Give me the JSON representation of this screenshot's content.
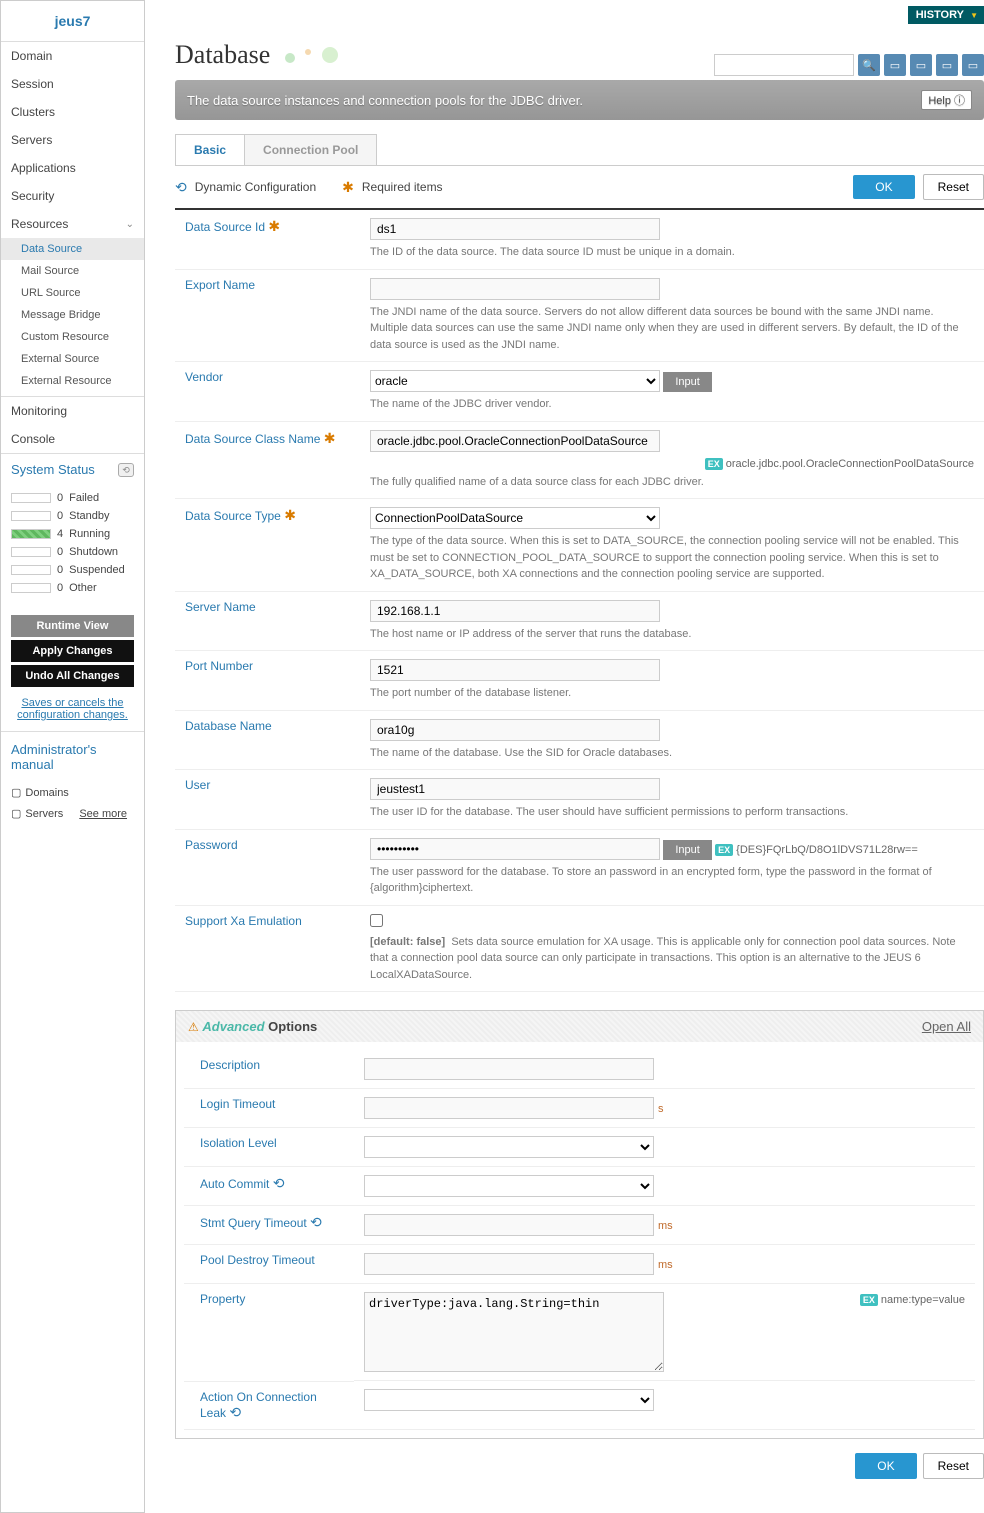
{
  "logo": "jeus7",
  "sidebar": {
    "main": [
      "Domain",
      "Session",
      "Clusters",
      "Servers",
      "Applications",
      "Security",
      "Resources"
    ],
    "resources_sub": [
      "Data Source",
      "Mail Source",
      "URL Source",
      "Message Bridge",
      "Custom Resource",
      "External Source",
      "External Resource"
    ],
    "monitoring": "Monitoring",
    "console": "Console",
    "system_status": "System Status",
    "status": [
      {
        "count": "0",
        "label": "Failed",
        "green": false
      },
      {
        "count": "0",
        "label": "Standby",
        "green": false
      },
      {
        "count": "4",
        "label": "Running",
        "green": true
      },
      {
        "count": "0",
        "label": "Shutdown",
        "green": false
      },
      {
        "count": "0",
        "label": "Suspended",
        "green": false
      },
      {
        "count": "0",
        "label": "Other",
        "green": false
      }
    ],
    "runtime_btn": "Runtime View",
    "apply_btn": "Apply Changes",
    "undo_btn": "Undo All Changes",
    "save_link": "Saves or cancels the configuration changes.",
    "admin_title": "Administrator's manual",
    "admin_items": [
      "Domains",
      "Servers"
    ],
    "see_more": "See more"
  },
  "history": "HISTORY",
  "page_title": "Database",
  "subtitle": "The data source instances and connection pools for the JDBC driver.",
  "help": "Help ⓘ",
  "tabs": [
    "Basic",
    "Connection Pool"
  ],
  "legend": {
    "dynamic": "Dynamic Configuration",
    "required": "Required items"
  },
  "ok": "OK",
  "reset": "Reset",
  "fields": {
    "datasource_id": {
      "label": "Data Source Id",
      "value": "ds1",
      "desc": "The ID of the data source. The data source ID must be unique in a domain.",
      "required": true
    },
    "export_name": {
      "label": "Export Name",
      "value": "",
      "desc": "The JNDI name of the data source. Servers do not allow different data sources be bound with the same JNDI name. Multiple data sources can use the same JNDI name only when they are used in different servers. By default, the ID of the data source is used as the JNDI name."
    },
    "vendor": {
      "label": "Vendor",
      "value": "oracle",
      "desc": "The name of the JDBC driver vendor.",
      "input_btn": "Input"
    },
    "ds_class": {
      "label": "Data Source Class Name",
      "value": "oracle.jdbc.pool.OracleConnectionPoolDataSource",
      "ex": "oracle.jdbc.pool.OracleConnectionPoolDataSource",
      "desc": "The fully qualified name of a data source class for each JDBC driver.",
      "required": true
    },
    "ds_type": {
      "label": "Data Source Type",
      "value": "ConnectionPoolDataSource",
      "desc": "The type of the data source. When this is set to DATA_SOURCE, the connection pooling service will not be enabled. This must be set to CONNECTION_POOL_DATA_SOURCE to support the connection pooling service. When this is set to XA_DATA_SOURCE, both XA connections and the connection pooling service are supported.",
      "required": true
    },
    "server_name": {
      "label": "Server Name",
      "value": "192.168.1.1",
      "desc": "The host name or IP address of the server that runs the database."
    },
    "port": {
      "label": "Port Number",
      "value": "1521",
      "desc": "The port number of the database listener."
    },
    "db_name": {
      "label": "Database Name",
      "value": "ora10g",
      "desc": "The name of the database. Use the SID for Oracle databases."
    },
    "user": {
      "label": "User",
      "value": "jeustest1",
      "desc": "The user ID for the database. The user should have sufficient permissions to perform transactions."
    },
    "password": {
      "label": "Password",
      "value": "••••••••••",
      "input_btn": "Input",
      "ex": "{DES}FQrLbQ/D8O1lDVS71L28rw==",
      "desc": "The user password for the database. To store an password in an encrypted form, type the password in the format of {algorithm}ciphertext."
    },
    "xa": {
      "label": "Support Xa Emulation",
      "default": "[default: false]",
      "desc": "Sets data source emulation for XA usage. This is applicable only for connection pool data sources. Note that a connection pool data source can only participate in transactions. This option is an alternative to the JEUS 6 LocalXADataSource."
    }
  },
  "adv": {
    "title_a": "Advanced",
    "title_b": " Options",
    "open_all": "Open All",
    "description": {
      "label": "Description",
      "value": ""
    },
    "login_timeout": {
      "label": "Login Timeout",
      "value": "",
      "unit": "s"
    },
    "isolation": {
      "label": "Isolation Level",
      "value": ""
    },
    "autocommit": {
      "label": "Auto Commit",
      "value": "",
      "dyn": true
    },
    "stmt_timeout": {
      "label": "Stmt Query Timeout",
      "value": "",
      "unit": "ms",
      "dyn": true
    },
    "pool_destroy": {
      "label": "Pool Destroy Timeout",
      "value": "",
      "unit": "ms"
    },
    "property": {
      "label": "Property",
      "value": "driverType:java.lang.String=thin",
      "ex": "name:type=value"
    },
    "action_leak": {
      "label": "Action On Connection Leak",
      "value": "",
      "dyn": true
    }
  }
}
